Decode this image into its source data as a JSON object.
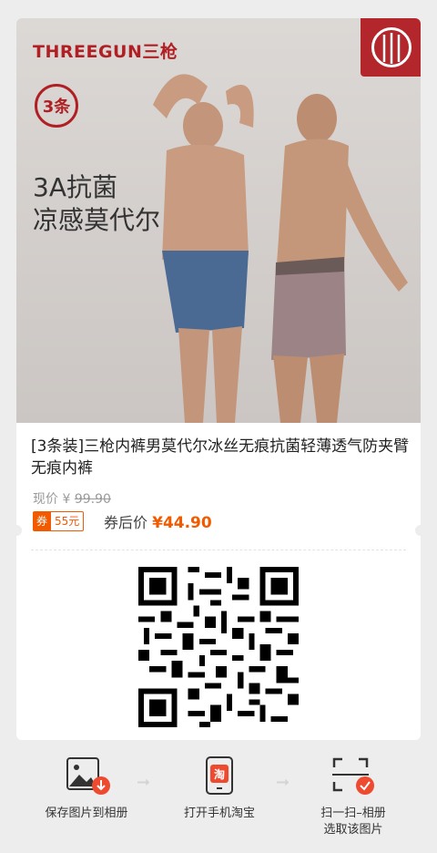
{
  "brand": "THREEGUN三枪",
  "badge": "3条",
  "slogan": [
    "3A抗菌",
    "凉感莫代尔"
  ],
  "product": {
    "title": "[3条装]三枪内裤男莫代尔冰丝无痕抗菌轻薄透气防夹臂无痕内裤",
    "now_label": "现价 ¥",
    "now_price": "99.90",
    "coupon_key": "券",
    "coupon_value": "55元",
    "after_label": "券后价",
    "after_price": "¥44.90"
  },
  "steps": [
    {
      "label": "保存图片到相册",
      "icon": "image-download-icon"
    },
    {
      "label": "打开手机淘宝",
      "icon": "taobao-phone-icon"
    },
    {
      "label": "扫一扫–相册\n选取该图片",
      "icon": "scan-icon"
    }
  ],
  "colors": {
    "brand_red": "#b01f24",
    "accent_orange": "#f25a00"
  }
}
